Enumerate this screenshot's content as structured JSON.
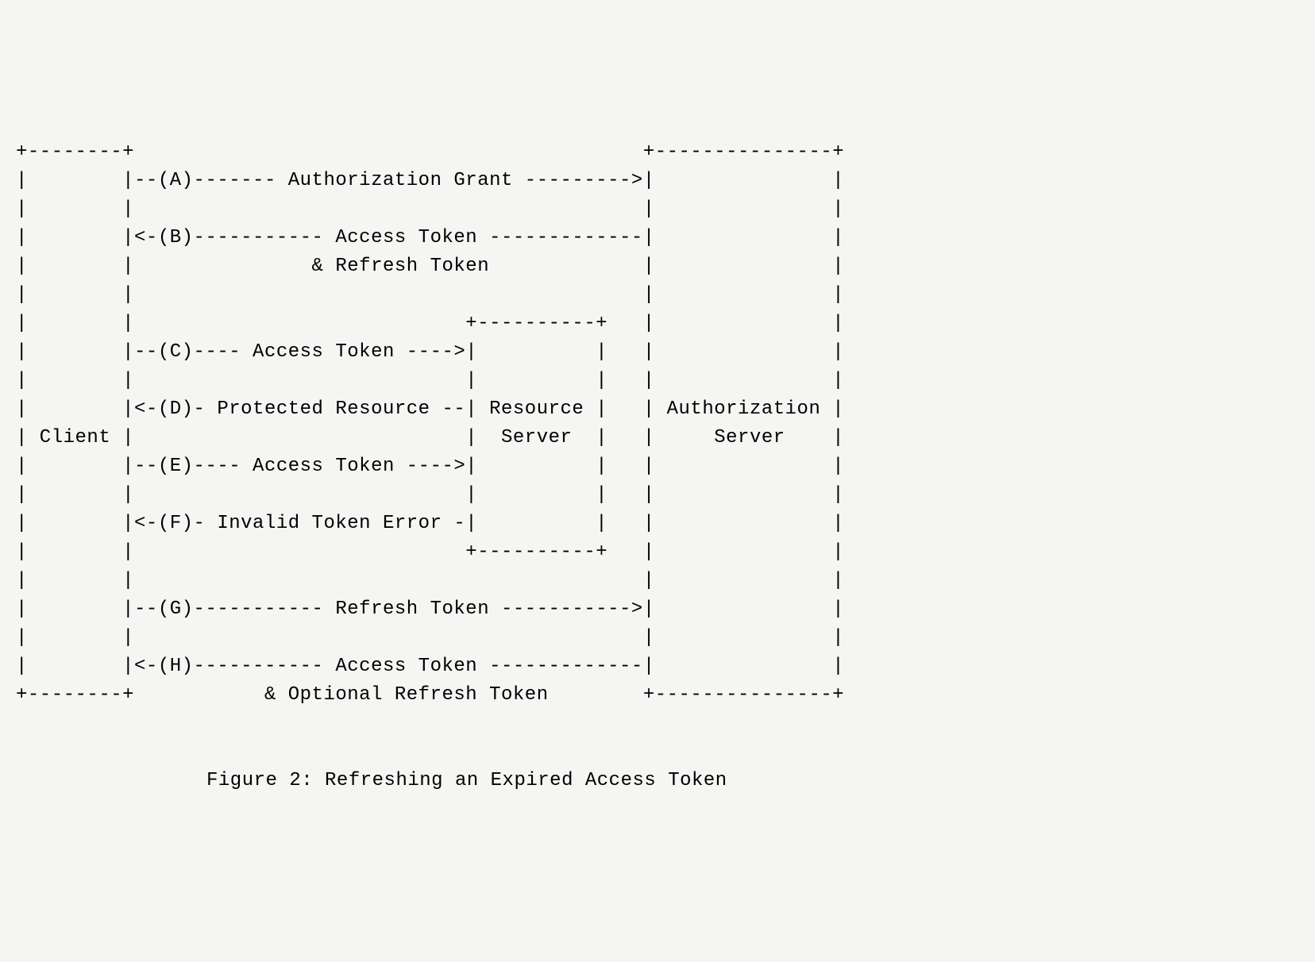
{
  "diagram": {
    "lines": [
      "+--------+                                           +---------------+",
      "|        |--(A)------- Authorization Grant --------->|               |",
      "|        |                                           |               |",
      "|        |<-(B)----------- Access Token -------------|               |",
      "|        |               & Refresh Token             |               |",
      "|        |                                           |               |",
      "|        |                            +----------+   |               |",
      "|        |--(C)---- Access Token ---->|          |   |               |",
      "|        |                            |          |   |               |",
      "|        |<-(D)- Protected Resource --| Resource |   | Authorization |",
      "| Client |                            |  Server  |   |     Server    |",
      "|        |--(E)---- Access Token ---->|          |   |               |",
      "|        |                            |          |   |               |",
      "|        |<-(F)- Invalid Token Error -|          |   |               |",
      "|        |                            +----------+   |               |",
      "|        |                                           |               |",
      "|        |--(G)----------- Refresh Token ----------->|               |",
      "|        |                                           |               |",
      "|        |<-(H)----------- Access Token -------------|               |",
      "+--------+           & Optional Refresh Token        +---------------+"
    ],
    "caption": "Figure 2: Refreshing an Expired Access Token",
    "entities": {
      "client": "Client",
      "resource_server": "Resource Server",
      "authorization_server": "Authorization Server"
    },
    "flows": [
      {
        "step": "A",
        "direction": "right",
        "from": "Client",
        "to": "Authorization Server",
        "label": "Authorization Grant"
      },
      {
        "step": "B",
        "direction": "left",
        "from": "Authorization Server",
        "to": "Client",
        "label": "Access Token & Refresh Token"
      },
      {
        "step": "C",
        "direction": "right",
        "from": "Client",
        "to": "Resource Server",
        "label": "Access Token"
      },
      {
        "step": "D",
        "direction": "left",
        "from": "Resource Server",
        "to": "Client",
        "label": "Protected Resource"
      },
      {
        "step": "E",
        "direction": "right",
        "from": "Client",
        "to": "Resource Server",
        "label": "Access Token"
      },
      {
        "step": "F",
        "direction": "left",
        "from": "Resource Server",
        "to": "Client",
        "label": "Invalid Token Error"
      },
      {
        "step": "G",
        "direction": "right",
        "from": "Client",
        "to": "Authorization Server",
        "label": "Refresh Token"
      },
      {
        "step": "H",
        "direction": "left",
        "from": "Authorization Server",
        "to": "Client",
        "label": "Access Token & Optional Refresh Token"
      }
    ]
  }
}
